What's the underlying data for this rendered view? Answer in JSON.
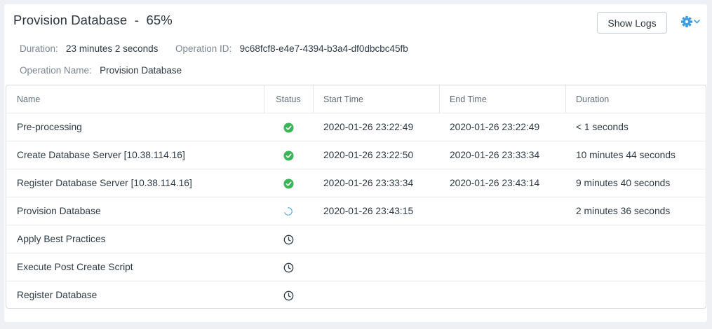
{
  "header": {
    "title": "Provision Database  -  65%",
    "show_logs_label": "Show Logs",
    "settings_icon": "gear-icon",
    "settings_caret_icon": "chevron-down-icon",
    "accent_color": "#3d9ee5"
  },
  "meta": {
    "duration_label": "Duration:",
    "duration_value": "23 minutes 2 seconds",
    "operation_id_label": "Operation ID:",
    "operation_id_value": "9c68fcf8-e4e7-4394-b3a4-df0dbcbc45fb",
    "operation_name_label": "Operation Name:",
    "operation_name_value": "Provision Database"
  },
  "table": {
    "columns": [
      "Name",
      "Status",
      "Start Time",
      "End Time",
      "Duration"
    ],
    "rows": [
      {
        "name": "Pre-processing",
        "status": "success",
        "start": "2020-01-26 23:22:49",
        "end": "2020-01-26 23:22:49",
        "duration": "< 1 seconds"
      },
      {
        "name": "Create Database Server [10.38.114.16]",
        "status": "success",
        "start": "2020-01-26 23:22:50",
        "end": "2020-01-26 23:33:34",
        "duration": "10 minutes 44 seconds"
      },
      {
        "name": "Register Database Server [10.38.114.16]",
        "status": "success",
        "start": "2020-01-26 23:33:34",
        "end": "2020-01-26 23:43:14",
        "duration": "9 minutes 40 seconds"
      },
      {
        "name": "Provision Database",
        "status": "running",
        "start": "2020-01-26 23:43:15",
        "end": "",
        "duration": "2 minutes 36 seconds"
      },
      {
        "name": "Apply Best Practices",
        "status": "pending",
        "start": "",
        "end": "",
        "duration": ""
      },
      {
        "name": "Execute Post Create Script",
        "status": "pending",
        "start": "",
        "end": "",
        "duration": ""
      },
      {
        "name": "Register Database",
        "status": "pending",
        "start": "",
        "end": "",
        "duration": ""
      }
    ]
  },
  "status_icons": {
    "success": "check-circle-icon",
    "running": "spinner-icon",
    "pending": "clock-icon"
  },
  "colors": {
    "success": "#3cb55a",
    "running": "#5aaee8",
    "pending": "#2d3a45"
  }
}
